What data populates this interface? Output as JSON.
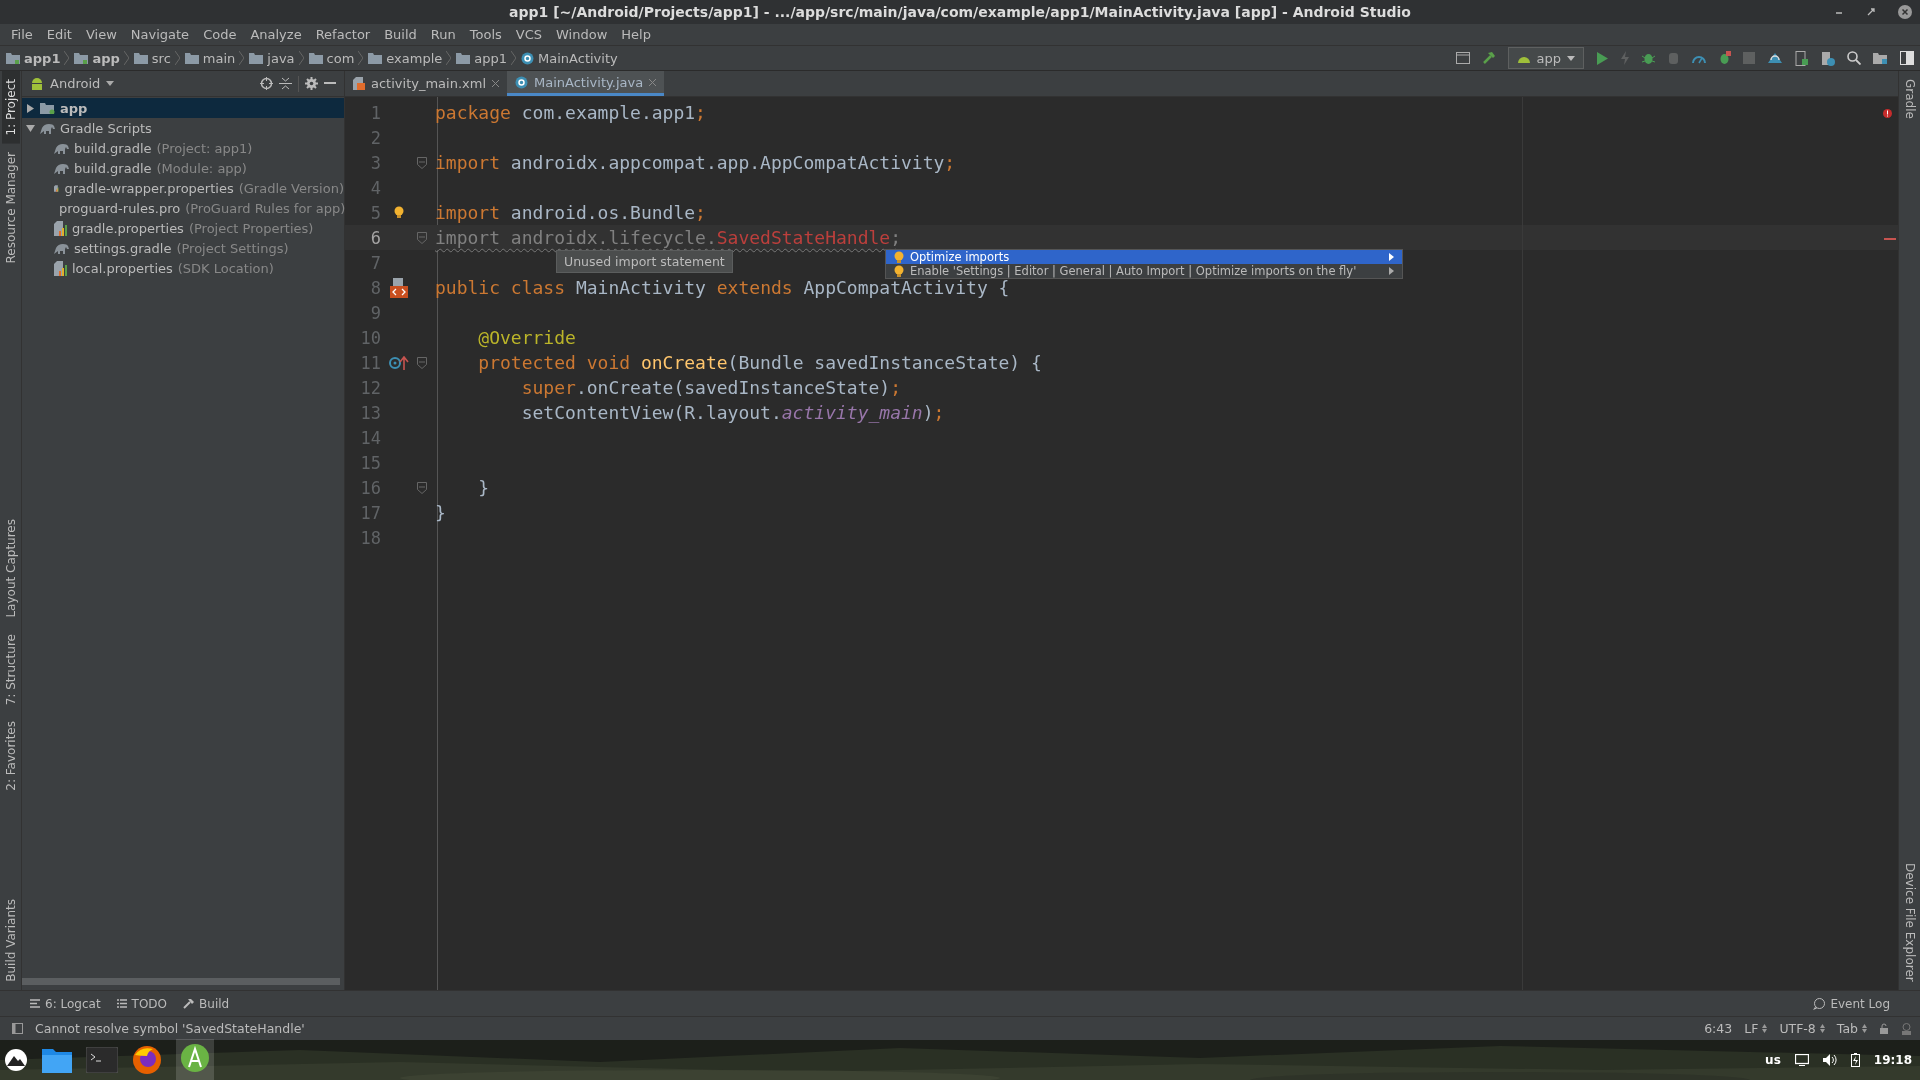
{
  "window": {
    "title": "app1 [~/Android/Projects/app1] - .../app/src/main/java/com/example/app1/MainActivity.java [app] - Android Studio"
  },
  "menu": [
    "File",
    "Edit",
    "View",
    "Navigate",
    "Code",
    "Analyze",
    "Refactor",
    "Build",
    "Run",
    "Tools",
    "VCS",
    "Window",
    "Help"
  ],
  "breadcrumb": [
    {
      "label": "app1",
      "kind": "module"
    },
    {
      "label": "app",
      "kind": "module"
    },
    {
      "label": "src",
      "kind": "folder"
    },
    {
      "label": "main",
      "kind": "folder"
    },
    {
      "label": "java",
      "kind": "folder"
    },
    {
      "label": "com",
      "kind": "folder"
    },
    {
      "label": "example",
      "kind": "folder"
    },
    {
      "label": "app1",
      "kind": "folder"
    },
    {
      "label": "MainActivity",
      "kind": "class"
    }
  ],
  "run_config": {
    "label": "app"
  },
  "left_tool_tabs": [
    {
      "label": "1: Project",
      "selected": true
    },
    {
      "label": "Resource Manager",
      "selected": false
    },
    {
      "label": "Layout Captures",
      "selected": false
    },
    {
      "label": "7: Structure",
      "selected": false
    },
    {
      "label": "2: Favorites",
      "selected": false
    },
    {
      "label": "Build Variants",
      "selected": false
    }
  ],
  "right_tool_tabs": [
    {
      "label": "Gradle"
    },
    {
      "label": "Device File Explorer"
    }
  ],
  "project": {
    "view": "Android",
    "tree": [
      {
        "name": "app",
        "kind": "module",
        "selected": true,
        "expanded": false
      },
      {
        "name": "Gradle Scripts",
        "kind": "gradle",
        "selected": false,
        "expanded": true,
        "children": [
          {
            "name": "build.gradle",
            "hint": "(Project: app1)",
            "kind": "gradle",
            "selected": false
          },
          {
            "name": "build.gradle",
            "hint": "(Module: app)",
            "kind": "gradle",
            "selected": false
          },
          {
            "name": "gradle-wrapper.properties",
            "hint": "(Gradle Version)",
            "kind": "properties",
            "selected": false
          },
          {
            "name": "proguard-rules.pro",
            "hint": "(ProGuard Rules for app)",
            "kind": "file",
            "selected": false
          },
          {
            "name": "gradle.properties",
            "hint": "(Project Properties)",
            "kind": "properties",
            "selected": false
          },
          {
            "name": "settings.gradle",
            "hint": "(Project Settings)",
            "kind": "gradle",
            "selected": false
          },
          {
            "name": "local.properties",
            "hint": "(SDK Location)",
            "kind": "properties",
            "selected": false
          }
        ]
      }
    ]
  },
  "editor_tabs": [
    {
      "label": "activity_main.xml",
      "kind": "xml",
      "selected": false
    },
    {
      "label": "MainActivity.java",
      "kind": "class",
      "selected": true
    }
  ],
  "code": {
    "lines": [
      {
        "number": "1",
        "highlighted": false,
        "fold": false,
        "tokens": [
          {
            "text": "package ",
            "kind": "keyword"
          },
          {
            "text": "com.example.app1",
            "kind": "plain"
          },
          {
            "text": ";",
            "kind": "keyword"
          }
        ]
      },
      {
        "number": "2",
        "highlighted": false,
        "fold": false
      },
      {
        "number": "3",
        "highlighted": false,
        "fold": true,
        "tokens": [
          {
            "text": "import ",
            "kind": "keyword"
          },
          {
            "text": "androidx.appcompat.app.AppCompatActivity",
            "kind": "plain"
          },
          {
            "text": ";",
            "kind": "keyword"
          }
        ]
      },
      {
        "number": "4",
        "highlighted": false,
        "fold": false
      },
      {
        "number": "5",
        "highlighted": false,
        "fold": false,
        "kind": "bulb",
        "tokens": [
          {
            "text": "import ",
            "kind": "keyword"
          },
          {
            "text": "android.os.Bundle",
            "kind": "plain"
          },
          {
            "text": ";",
            "kind": "keyword"
          }
        ]
      },
      {
        "number": "6",
        "highlighted": true,
        "fold": true,
        "tokens": [
          {
            "text": "import androidx.lifecycle.",
            "kind": "unused"
          },
          {
            "text": "SavedStateHandle",
            "kind": "error"
          },
          {
            "text": ";",
            "kind": "unused"
          }
        ]
      },
      {
        "number": "7",
        "highlighted": false,
        "fold": false
      },
      {
        "number": "8",
        "highlighted": false,
        "fold": false,
        "kind": "layout",
        "tokens": [
          {
            "text": "public class ",
            "kind": "keyword"
          },
          {
            "text": "MainActivity ",
            "kind": "plain"
          },
          {
            "text": "extends ",
            "kind": "keyword"
          },
          {
            "text": "AppCompatActivity {",
            "kind": "plain"
          }
        ]
      },
      {
        "number": "9",
        "highlighted": false,
        "fold": false
      },
      {
        "number": "10",
        "highlighted": false,
        "fold": false,
        "tokens": [
          {
            "text": "    @Override",
            "kind": "annotation"
          }
        ]
      },
      {
        "number": "11",
        "highlighted": false,
        "fold": true,
        "kind": "override",
        "tokens": [
          {
            "text": "    protected void ",
            "kind": "keyword"
          },
          {
            "text": "onCreate",
            "kind": "method"
          },
          {
            "text": "(Bundle savedInstanceState) {",
            "kind": "plain"
          }
        ]
      },
      {
        "number": "12",
        "highlighted": false,
        "fold": false,
        "tokens": [
          {
            "text": "        super",
            "kind": "keyword"
          },
          {
            "text": ".onCreate(savedInstanceState)",
            "kind": "plain"
          },
          {
            "text": ";",
            "kind": "keyword"
          }
        ]
      },
      {
        "number": "13",
        "highlighted": false,
        "fold": false,
        "tokens": [
          {
            "text": "        setContentView(R.layout.",
            "kind": "plain"
          },
          {
            "text": "activity_main",
            "kind": "field"
          },
          {
            "text": ")",
            "kind": "plain"
          },
          {
            "text": ";",
            "kind": "keyword"
          }
        ]
      },
      {
        "number": "14",
        "highlighted": false,
        "fold": false
      },
      {
        "number": "15",
        "highlighted": false,
        "fold": false
      },
      {
        "number": "16",
        "highlighted": false,
        "fold": true,
        "tokens": [
          {
            "text": "    }",
            "kind": "plain"
          }
        ]
      },
      {
        "number": "17",
        "highlighted": false,
        "fold": false,
        "tokens": [
          {
            "text": "}",
            "kind": "plain"
          }
        ]
      },
      {
        "number": "18",
        "highlighted": false,
        "fold": false
      }
    ]
  },
  "tooltip": {
    "text": "Unused import statement"
  },
  "intention_menu": [
    {
      "label": "Optimize imports",
      "selected": true
    },
    {
      "label": "Enable 'Settings | Editor | General | Auto Import | Optimize imports on the fly'",
      "selected": false
    }
  ],
  "bottom_tool_tabs": [
    {
      "label": "6: Logcat",
      "kind": "logcat"
    },
    {
      "label": "TODO",
      "kind": "todo"
    },
    {
      "label": "Build",
      "kind": "build"
    }
  ],
  "event_log": {
    "label": "Event Log"
  },
  "status_bar": {
    "message": "Cannot resolve symbol 'SavedStateHandle'",
    "position": "6:43",
    "line_separator": "LF",
    "encoding": "UTF-8",
    "indent": "Tab"
  },
  "taskbar": {
    "keyboard": "us",
    "clock": "19:18"
  }
}
